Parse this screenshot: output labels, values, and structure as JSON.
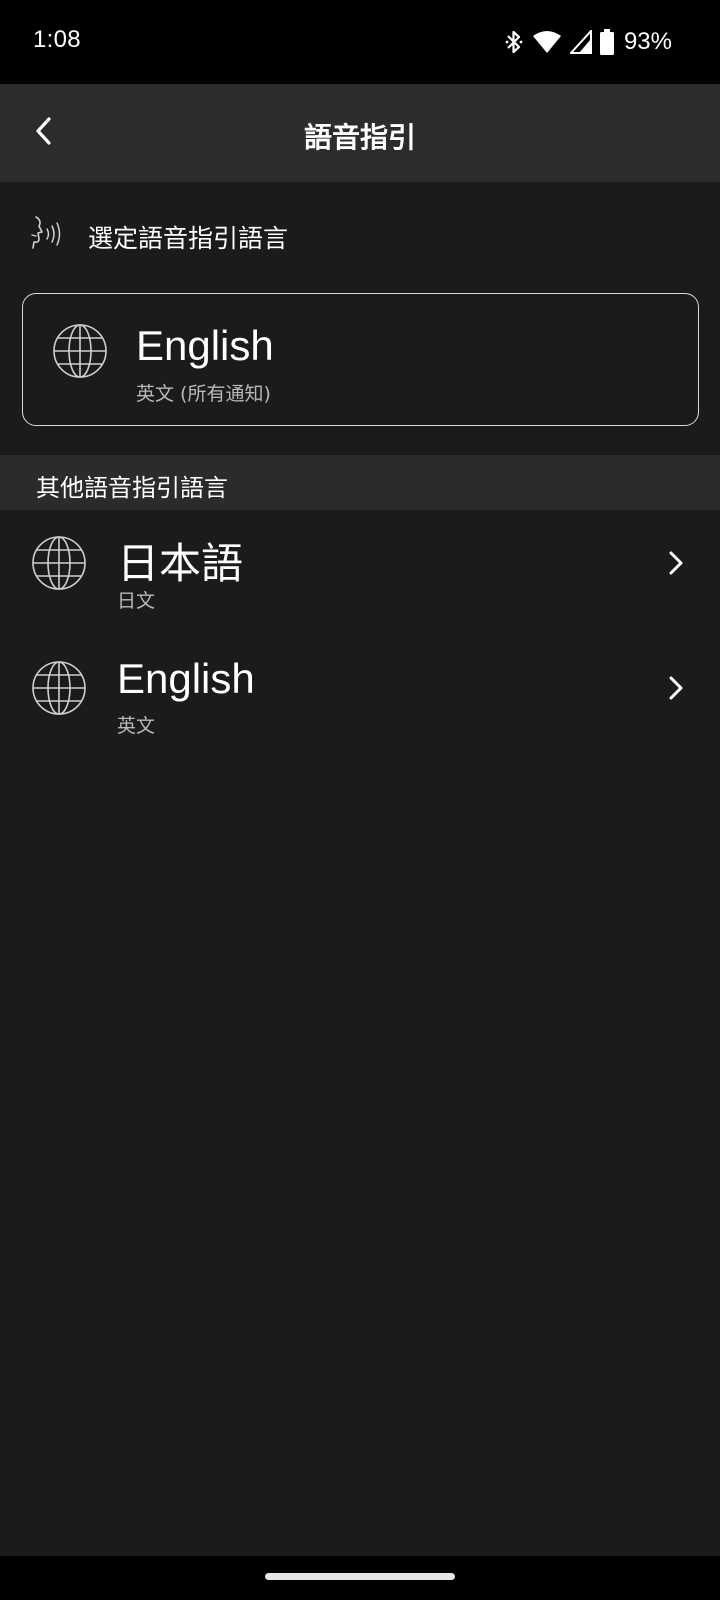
{
  "status_bar": {
    "time": "1:08",
    "battery_percent": "93%",
    "icons": [
      "bluetooth-icon",
      "wifi-icon",
      "signal-icon",
      "battery-icon"
    ]
  },
  "header": {
    "title": "語音指引",
    "back_icon": "chevron-left-icon"
  },
  "select_section": {
    "icon": "speaking-head-icon",
    "label": "選定語音指引語言"
  },
  "current_language": {
    "name": "English",
    "subtitle": "英文 (所有通知)",
    "icon": "globe-icon"
  },
  "other_section": {
    "title": "其他語音指引語言",
    "items": [
      {
        "name": "日本語",
        "subtitle": "日文",
        "icon": "globe-icon"
      },
      {
        "name": "English",
        "subtitle": "英文",
        "icon": "globe-icon"
      }
    ]
  },
  "colors": {
    "background": "#1b1b1b",
    "app_bar": "#2c2c2c",
    "section_header": "#2b2b2b",
    "secondary_text": "#b8b8b8"
  }
}
